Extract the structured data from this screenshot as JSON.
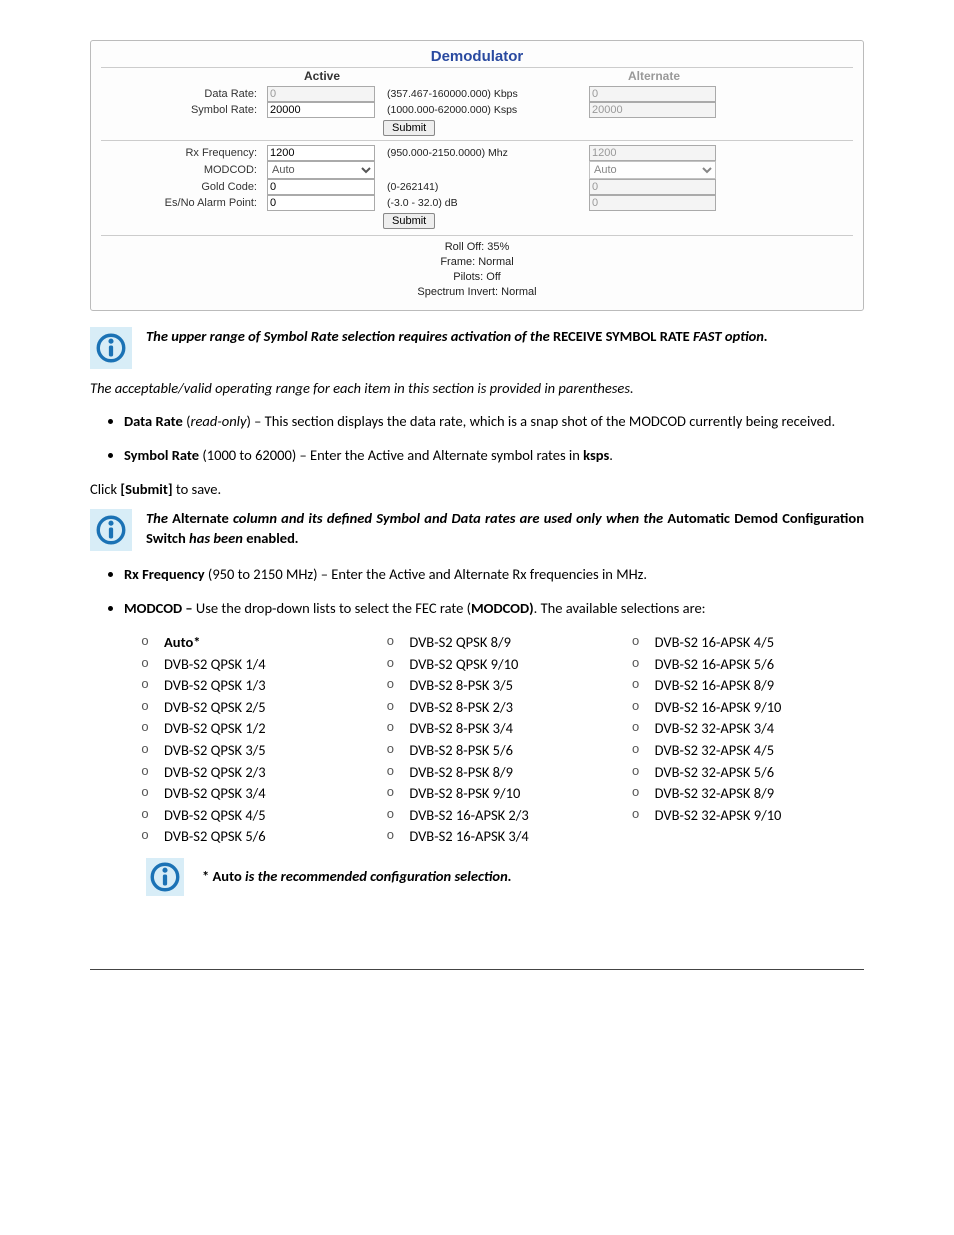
{
  "panel": {
    "title": "Demodulator",
    "head_active": "Active",
    "head_alt": "Alternate",
    "row1_label": "Data Rate:",
    "row1_active": "0",
    "row1_range": "(357.467-160000.000) Kbps",
    "row1_alt": "0",
    "row2_label": "Symbol Rate:",
    "row2_active": "20000",
    "row2_range": "(1000.000-62000.000) Ksps",
    "row2_alt": "20000",
    "submit1": "Submit",
    "row3_label": "Rx Frequency:",
    "row3_active": "1200",
    "row3_range": "(950.000-2150.0000) Mhz",
    "row3_alt": "1200",
    "row4_label": "MODCOD:",
    "row4_sel": "Auto",
    "row4_alt_sel": "Auto",
    "row5_label": "Gold Code:",
    "row5_active": "0",
    "row5_range": "(0-262141)",
    "row5_alt": "0",
    "row6_label": "Es/No Alarm Point:",
    "row6_active": "0",
    "row6_range": "(-3.0 - 32.0) dB",
    "row6_alt": "0",
    "submit2": "Submit",
    "status1": "Roll Off: 35%",
    "status2": "Frame: Normal",
    "status3": "Pilots: Off",
    "status4": "Spectrum Invert: Normal"
  },
  "note1_a": "The upper range of Symbol Rate selection requires activation of the ",
  "note1_b": "RECEIVE SYMBOL RATE",
  "note1_c": " FAST option.",
  "line_acceptable": "The acceptable/valid operating range for each item in this section is provided in parentheses.",
  "b_data_rate_label": "Data Rate",
  "b_data_rate_ro": "read-only",
  "b_data_rate_txt": " – This section displays the data rate, which is a snap shot of the MODCOD currently being received.",
  "b_symbol_label": "Symbol Rate",
  "b_symbol_range": " (1000 to 62000) – Enter the Active and Alternate symbol rates in ",
  "b_symbol_unit": "ksps",
  "click_submit_a": "Click ",
  "click_submit_b": "[Submit]",
  "click_submit_c": " to save.",
  "note2_a": "The ",
  "note2_b": "Alternate",
  "note2_c": " column and its defined Symbol and Data rates are used only when the ",
  "note2_d": "Automatic Demod Configuration Switch",
  "note2_e": " has been ",
  "note2_f": "enabled",
  "note2_g": ".",
  "b_rx_label": "Rx Frequency",
  "b_rx_txt": " (950 to 2150 MHz) – Enter the Active and Alternate Rx frequencies in MHz.",
  "b_modcod_label": "MODCOD – ",
  "b_modcod_txt_a": "Use the drop-down lists to select the FEC rate (",
  "b_modcod_txt_b": "MODCOD)",
  "b_modcod_txt_c": ".  The available selections are:",
  "modcod_col1": [
    "Auto*",
    "DVB-S2 QPSK 1/4",
    "DVB-S2 QPSK 1/3",
    "DVB-S2 QPSK 2/5",
    "DVB-S2 QPSK 1/2",
    "DVB-S2 QPSK 3/5",
    "DVB-S2 QPSK 2/3",
    "DVB-S2 QPSK 3/4",
    "DVB-S2 QPSK 4/5",
    "DVB-S2 QPSK 5/6"
  ],
  "modcod_col2": [
    "DVB-S2 QPSK 8/9",
    "DVB-S2 QPSK 9/10",
    "DVB-S2 8-PSK 3/5",
    "DVB-S2 8-PSK 2/3",
    "DVB-S2 8-PSK 3/4",
    "DVB-S2 8-PSK 5/6",
    "DVB-S2 8-PSK 8/9",
    "DVB-S2 8-PSK 9/10",
    "DVB-S2 16-APSK 2/3",
    "DVB-S2 16-APSK 3/4"
  ],
  "modcod_col3": [
    "DVB-S2 16-APSK 4/5",
    "DVB-S2 16-APSK 5/6",
    "DVB-S2 16-APSK 8/9",
    "DVB-S2 16-APSK 9/10",
    "DVB-S2 32-APSK 3/4",
    "DVB-S2 32-APSK 4/5",
    "DVB-S2 32-APSK 5/6",
    "DVB-S2 32-APSK 8/9",
    "DVB-S2 32-APSK 9/10"
  ],
  "auto_note_a": "* Auto",
  "auto_note_b": " is the recommended configuration selection."
}
